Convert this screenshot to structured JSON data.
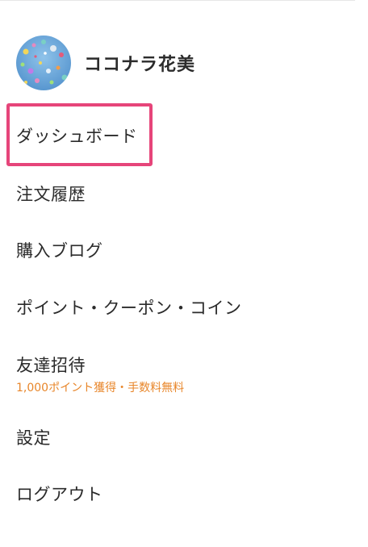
{
  "user": {
    "name": "ココナラ花美",
    "avatar_icon": "balloons-avatar"
  },
  "menu": {
    "dashboard": "ダッシュボード",
    "orders": "注文履歴",
    "purchase_blog": "購入ブログ",
    "points": "ポイント・クーポン・コイン",
    "invite": "友達招待",
    "invite_sub": "1,000ポイント獲得・手数料無料",
    "settings": "設定",
    "logout": "ログアウト"
  },
  "colors": {
    "highlight": "#e6457a",
    "accent_orange": "#e8862a",
    "text": "#2b2b2b"
  }
}
